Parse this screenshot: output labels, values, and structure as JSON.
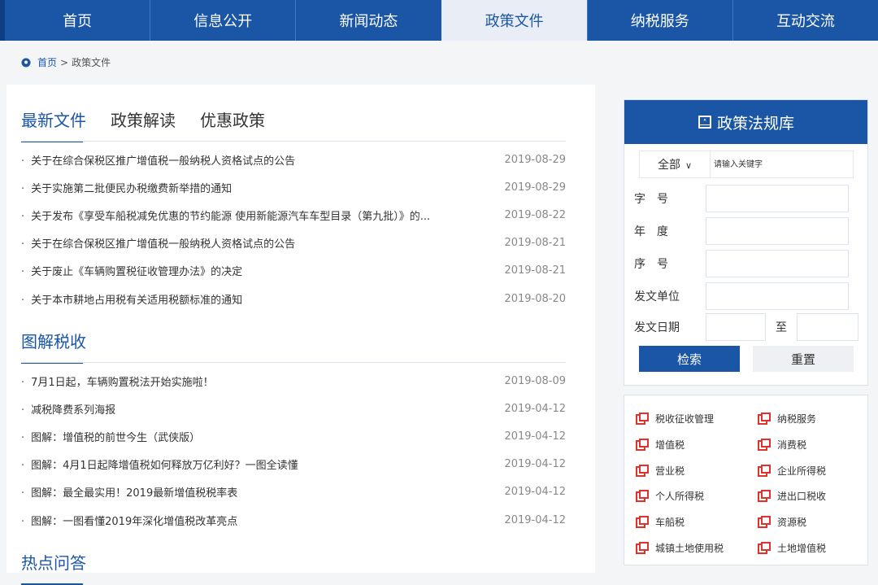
{
  "nav": [
    {
      "label": "首页",
      "active": false
    },
    {
      "label": "信息公开",
      "active": false
    },
    {
      "label": "新闻动态",
      "active": false
    },
    {
      "label": "政策文件",
      "active": true
    },
    {
      "label": "纳税服务",
      "active": false
    },
    {
      "label": "互动交流",
      "active": false
    }
  ],
  "breadcrumb": {
    "home": "首页",
    "separator": ">",
    "current": "政策文件"
  },
  "tabs": [
    "最新文件",
    "政策解读",
    "优惠政策"
  ],
  "latest": [
    {
      "title": "关于在综合保税区推广增值税一般纳税人资格试点的公告",
      "date": "2019-08-29"
    },
    {
      "title": "关于实施第二批便民办税缴费新举措的通知",
      "date": "2019-08-29"
    },
    {
      "title": "关于发布《享受车船税减免优惠的节约能源 使用新能源汽车车型目录（第九批）》的...",
      "date": "2019-08-22"
    },
    {
      "title": "关于在综合保税区推广增值税一般纳税人资格试点的公告",
      "date": "2019-08-21"
    },
    {
      "title": "关于废止《车辆购置税征收管理办法》的决定",
      "date": "2019-08-21"
    },
    {
      "title": "关于本市耕地占用税有关适用税额标准的通知",
      "date": "2019-08-20"
    }
  ],
  "section2": {
    "title": "图解税收"
  },
  "graphics": [
    {
      "title": "7月1日起，车辆购置税法开始实施啦！",
      "date": "2019-08-09"
    },
    {
      "title": "减税降费系列海报",
      "date": "2019-04-12"
    },
    {
      "title": "图解：增值税的前世今生（武侠版）",
      "date": "2019-04-12"
    },
    {
      "title": "图解：4月1日起降增值税如何释放万亿利好？一图全读懂",
      "date": "2019-04-12"
    },
    {
      "title": "图解：最全最实用！2019最新增值税税率表",
      "date": "2019-04-12"
    },
    {
      "title": "图解：一图看懂2019年深化增值税改革亮点",
      "date": "2019-04-12"
    }
  ],
  "section3": {
    "title": "热点问答"
  },
  "search": {
    "title": "政策法规库",
    "select_value": "全部",
    "keyword_placeholder": "请输入关键字",
    "fields": {
      "doc_no": "字　号",
      "year": "年　度",
      "seq": "序　号",
      "issuer": "发文单位",
      "date": "发文日期",
      "to": "至"
    },
    "search_btn": "检索",
    "reset_btn": "重置"
  },
  "categories": [
    "税收征收管理",
    "纳税服务",
    "增值税",
    "消费税",
    "营业税",
    "企业所得税",
    "个人所得税",
    "进出口税收",
    "车船税",
    "资源税",
    "城镇土地使用税",
    "土地增值税"
  ],
  "colors": {
    "brand": "#1b56a6",
    "accent_red": "#e0322c"
  }
}
